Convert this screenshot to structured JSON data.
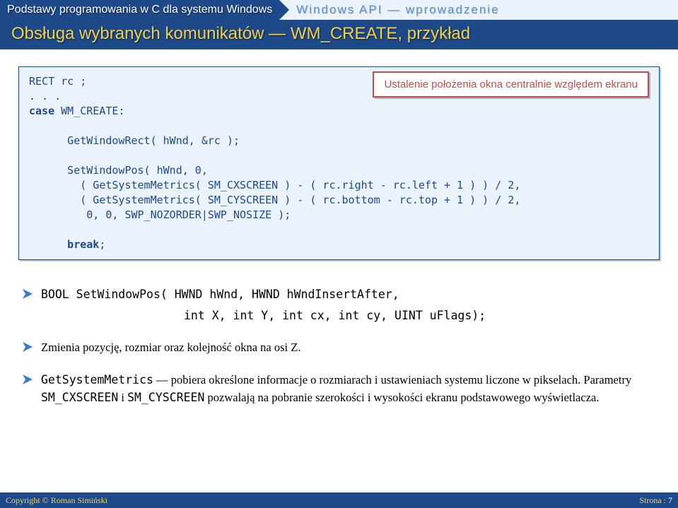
{
  "header": {
    "left": "Podstawy programowania w C dla systemu Windows",
    "right": "Windows API — wprowadzenie"
  },
  "title": "Obsługa wybranych komunikatów — WM_CREATE, przykład",
  "callout": "Ustalenie położenia okna centralnie względem ekranu",
  "code": {
    "l1": "RECT rc ;",
    "l2": ". . .",
    "l3a": "case",
    "l3b": " WM_CREATE:",
    "l4": "      GetWindowRect( hWnd, &rc );",
    "l5": "      SetWindowPos( hWnd, 0,",
    "l6": "        ( GetSystemMetrics( SM_CXSCREEN ) - ( rc.right - rc.left + 1 ) ) / 2,",
    "l7": "        ( GetSystemMetrics( SM_CYSCREEN ) - ( rc.bottom - rc.top + 1 ) ) / 2,",
    "l8": "         0, 0, SWP_NOZORDER|SWP_NOSIZE );",
    "l9a": "      break",
    "l9b": ";"
  },
  "bullets": {
    "b1_sig1": "BOOL SetWindowPos(  HWND hWnd, HWND hWndInsertAfter,",
    "b1_sig2": "int X, int Y, int cx, int cy, UINT uFlags);",
    "b2": "Zmienia pozycję, rozmiar oraz kolejność okna na osi  Z.",
    "b3_p1": "GetSystemMetrics",
    "b3_p2": " — pobiera określone informacje o rozmiarach i ustawieniach systemu liczone w pikselach. Parametry ",
    "b3_p3": "SM_CXSCREEN",
    "b3_p4": " i ",
    "b3_p5": "SM_CYSCREEN",
    "b3_p6": " pozwalają na pobranie szerokości i wysokości ekranu podstawowego wyświetlacza."
  },
  "footer": {
    "left": "Copyright © Roman Simiński",
    "right_label": "Strona : ",
    "page": "7"
  }
}
